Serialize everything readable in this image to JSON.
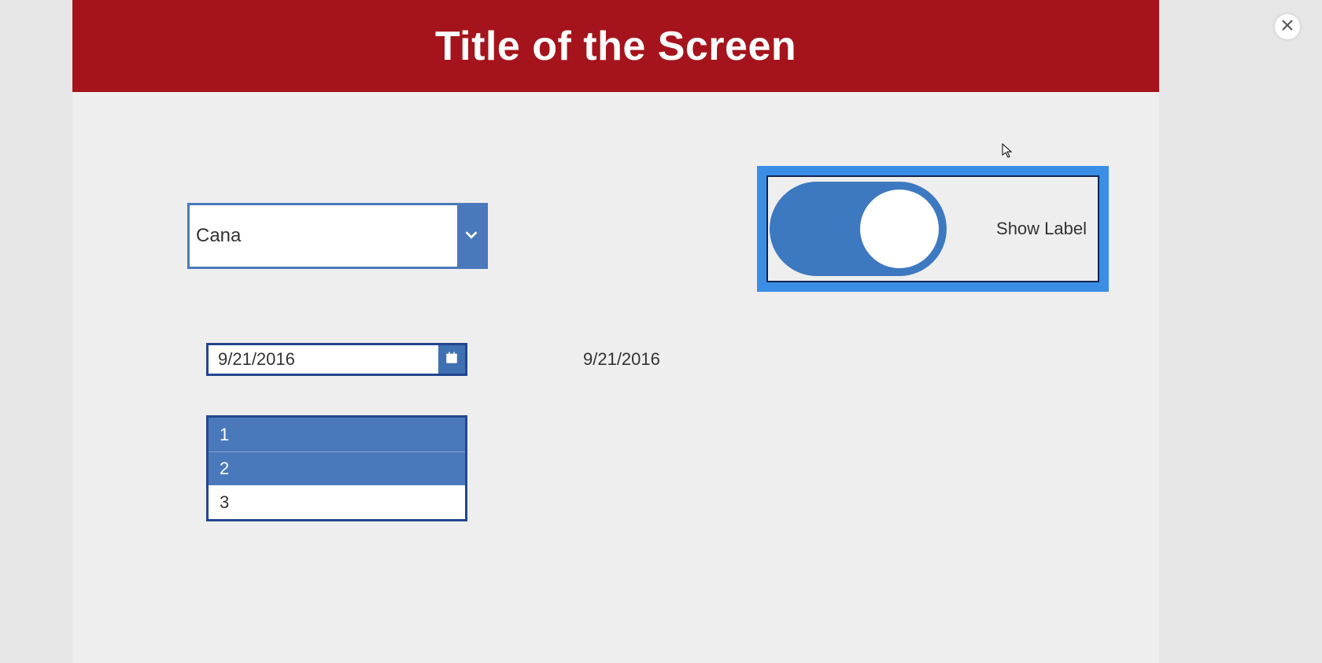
{
  "header": {
    "title": "Title of the Screen"
  },
  "dropdown": {
    "value": "Cana"
  },
  "toggle": {
    "label": "Show Label",
    "state": "on"
  },
  "date_picker": {
    "value": "9/21/2016"
  },
  "date_display": "9/21/2016",
  "listbox": {
    "items": [
      {
        "label": "1",
        "selected": true
      },
      {
        "label": "2",
        "selected": true
      },
      {
        "label": "3",
        "selected": false
      }
    ]
  },
  "colors": {
    "header_bg": "#a5141c",
    "accent_blue": "#4a79bb",
    "focus_blue": "#3b8ee6",
    "dark_blue": "#23468e"
  }
}
